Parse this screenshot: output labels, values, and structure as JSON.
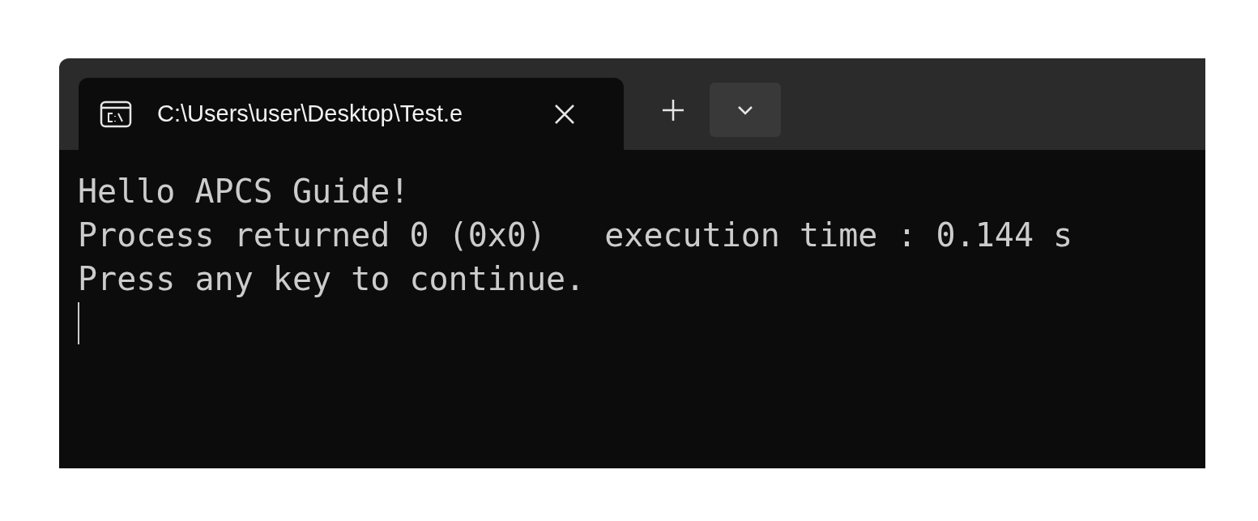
{
  "tab": {
    "title": "C:\\Users\\user\\Desktop\\Test.e",
    "selected": true
  },
  "console": {
    "lines": [
      "Hello APCS Guide!",
      "Process returned 0 (0x0)   execution time : 0.144 s",
      "Press any key to continue."
    ]
  }
}
